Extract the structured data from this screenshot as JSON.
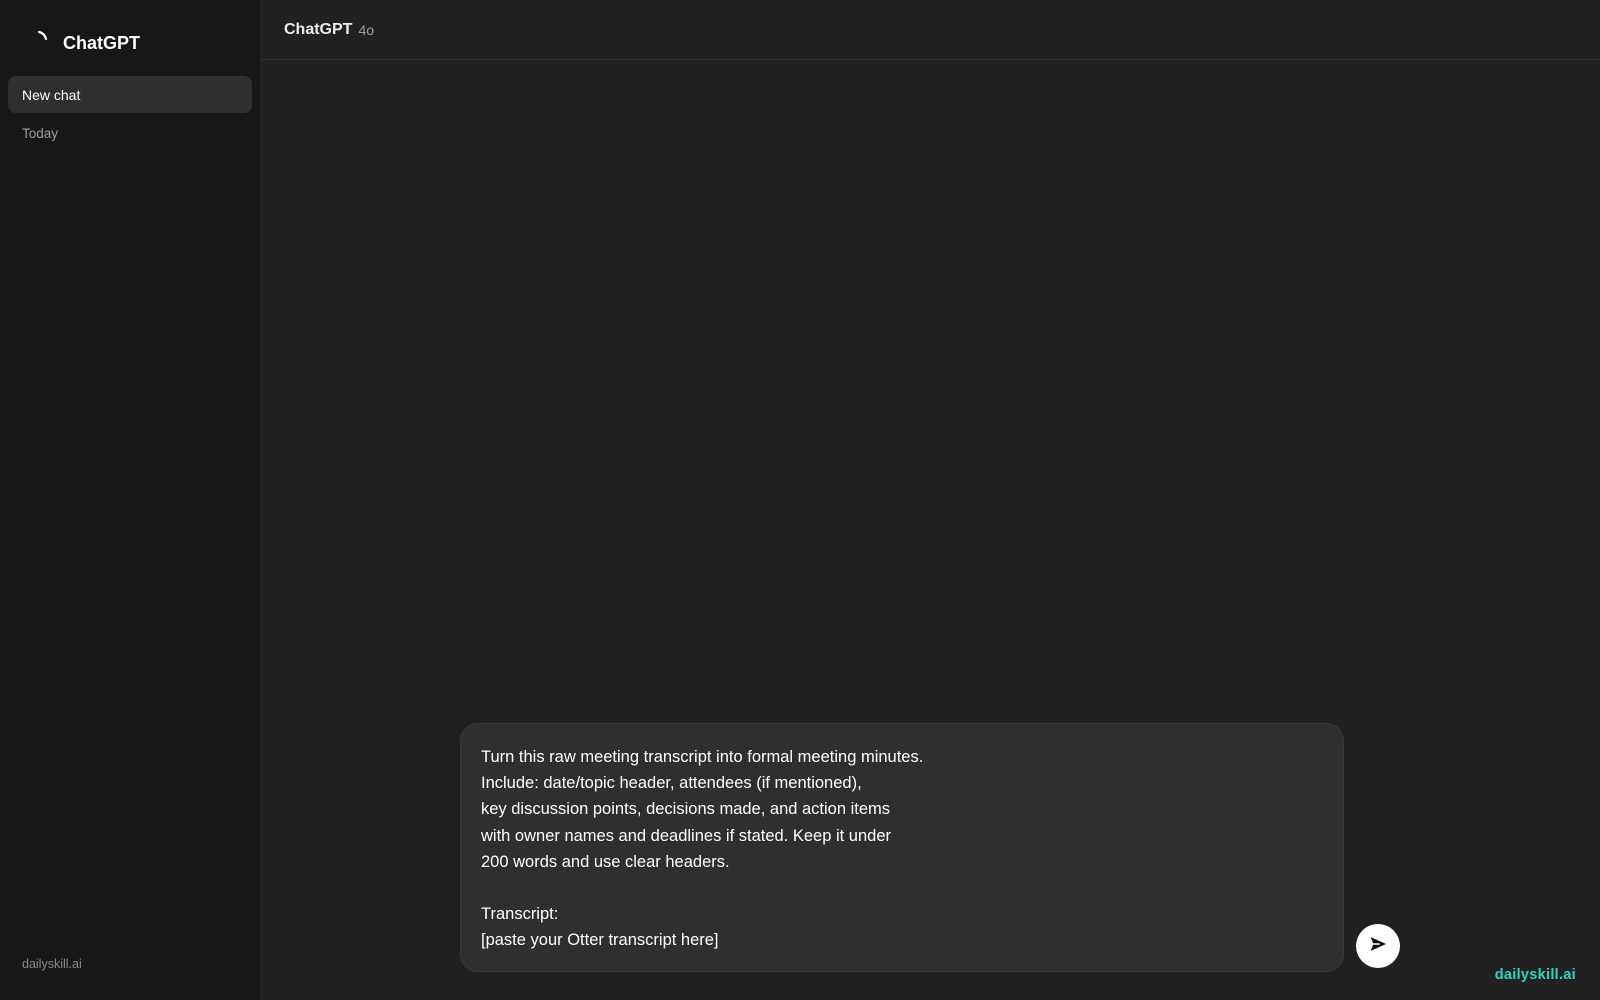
{
  "sidebar": {
    "brand_name": "ChatGPT",
    "new_chat_label": "New chat",
    "section_today": "Today",
    "footer_text": "dailyskill.ai"
  },
  "header": {
    "model_name": "ChatGPT",
    "model_version": "4o"
  },
  "composer": {
    "text": "Turn this raw meeting transcript into formal meeting minutes.\nInclude: date/topic header, attendees (if mentioned),\nkey discussion points, decisions made, and action items\nwith owner names and deadlines if stated. Keep it under\n200 words and use clear headers.\n\nTranscript:\n[paste your Otter transcript here]",
    "send_icon": "send-arrow-icon"
  },
  "watermark": "dailyskill.ai",
  "colors": {
    "sidebar_bg": "#171717",
    "main_bg": "#212121",
    "composer_bg": "#2f2f2f",
    "accent": "#2dd4bf"
  }
}
